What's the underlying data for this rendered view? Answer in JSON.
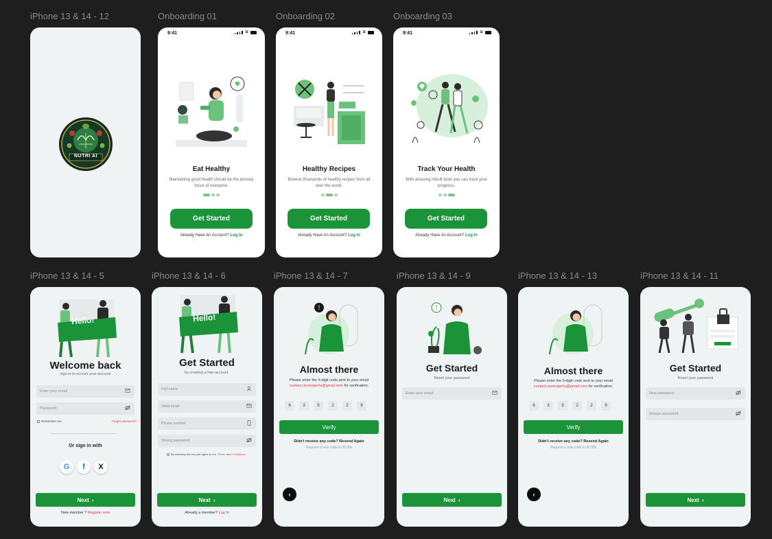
{
  "frames": {
    "splash": {
      "label": "iPhone 13 & 14 - 12",
      "logo_text": "NUTRI AI"
    },
    "onb1": {
      "label": "Onboarding 01",
      "time": "9:41",
      "title": "Eat Healthy",
      "subtitle": "Maintaining good health should be the primary focus of everyone.",
      "button": "Get Started",
      "footer_prefix": "Already Have An Account?",
      "footer_link": "Log In"
    },
    "onb2": {
      "label": "Onboarding 02",
      "time": "9:41",
      "title": "Healthy Recipes",
      "subtitle": "Browse thousands of healthy recipes from all over the world.",
      "button": "Get Started",
      "footer_prefix": "Already Have An Account?",
      "footer_link": "Log In"
    },
    "onb3": {
      "label": "Onboarding 03",
      "time": "9:41",
      "title": "Track Your Health",
      "subtitle": "With amazing inbuilt tools you can track your progress.",
      "button": "Get Started",
      "footer_prefix": "Already Have An Account?",
      "footer_link": "Log In"
    },
    "login": {
      "label": "iPhone 13 & 14 - 5",
      "hello": "Hello!",
      "title": "Welcome back",
      "subtitle": "sign in to access your account",
      "email_placeholder": "Enter your email",
      "password_placeholder": "Password",
      "remember": "Remember me",
      "forgot": "Forget password?",
      "or_sign_in": "Or sign in with",
      "social": [
        "G",
        "f",
        "X"
      ],
      "button": "Next",
      "footer_prefix": "New member ?",
      "footer_link": "Register now"
    },
    "signup": {
      "label": "iPhone 13 & 14 - 6",
      "hello": "Hello!",
      "title": "Get Started",
      "subtitle": "by creating a free account.",
      "fields": [
        "Full name",
        "Valid email",
        "Phone number",
        "Strong password"
      ],
      "terms_prefix": "By checking the box you agree to our",
      "terms_link1": "Terms",
      "terms_and": "and",
      "terms_link2": "Conditions",
      "button": "Next",
      "footer_prefix": "Already a member?",
      "footer_link": "Log In"
    },
    "verify1": {
      "label": "iPhone 13 & 14 - 7",
      "title": "Almost there",
      "msg_prefix": "Please enter the 6-digit code sent to your email",
      "email": "contact.uiuxexperts@gmail.com",
      "msg_suffix": "for verification.",
      "code": [
        "6",
        "3",
        "5",
        "2",
        "2",
        "9"
      ],
      "button": "Verify",
      "resend": "Didn't receive any code? Resend Again",
      "timer": "Request a new code in 00:30s",
      "back_icon": "chevron-left-icon"
    },
    "reset": {
      "label": "iPhone 13 & 14 - 9",
      "title": "Get Started",
      "subtitle": "Reset your password",
      "email_placeholder": "Enter your email",
      "button": "Next"
    },
    "verify2": {
      "label": "iPhone 13 & 14 - 13",
      "title": "Almost there",
      "msg_prefix": "Please enter the 6-digit code sent to your email",
      "email": "contact.uiuxexperts@gmail.com",
      "msg_suffix": "for verification.",
      "code": [
        "6",
        "3",
        "5",
        "2",
        "2",
        "9"
      ],
      "button": "Verify",
      "resend": "Didn't receive any code? Resend Again",
      "timer": "Request a new code in 00:30s",
      "back_icon": "chevron-left-icon"
    },
    "newpw": {
      "label": "iPhone 13 & 14 - 11",
      "title": "Get Started",
      "subtitle": "Reset your password",
      "new_password": "New password",
      "retype_password": "Retype password",
      "button": "Next"
    }
  },
  "colors": {
    "brand_green": "#1a9339",
    "light_green": "#a8d5b0",
    "link_red": "#e8344a",
    "canvas": "#1e1e1e"
  }
}
